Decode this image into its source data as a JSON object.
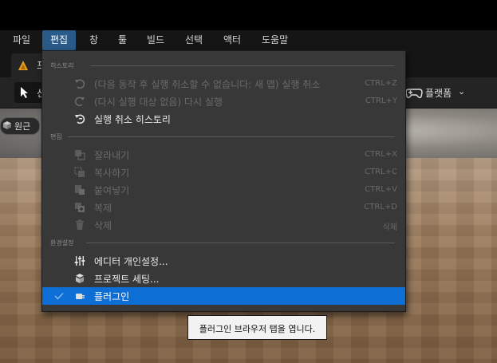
{
  "menubar": {
    "items": [
      "파일",
      "편집",
      "창",
      "툴",
      "빌드",
      "선택",
      "액터",
      "도움말"
    ],
    "active": "편집"
  },
  "doc_tab": {
    "label": "프"
  },
  "toolbar": {
    "select_label": "선",
    "platform_label": "플랫폼"
  },
  "viewport": {
    "perspective_label": "원근"
  },
  "dropdown": {
    "sections": [
      {
        "header": "히스토리",
        "items": [
          {
            "icon": "undo-icon",
            "label": "(다음 동작 후 실행 취소할 수 없습니다: 새 맵) 실행 취소",
            "shortcut": "CTRL+Z",
            "enabled": false
          },
          {
            "icon": "redo-icon",
            "label": "(다시 실행 대상 없음) 다시 실행",
            "shortcut": "CTRL+Y",
            "enabled": false
          },
          {
            "icon": "undo-history-icon",
            "label": "실행 취소 히스토리",
            "shortcut": "",
            "enabled": true
          }
        ]
      },
      {
        "header": "편집",
        "items": [
          {
            "icon": "cut-icon",
            "label": "잘라내기",
            "shortcut": "CTRL+X",
            "enabled": false
          },
          {
            "icon": "copy-icon",
            "label": "복사하기",
            "shortcut": "CTRL+C",
            "enabled": false
          },
          {
            "icon": "paste-icon",
            "label": "붙여넣기",
            "shortcut": "CTRL+V",
            "enabled": false
          },
          {
            "icon": "duplicate-icon",
            "label": "복제",
            "shortcut": "CTRL+D",
            "enabled": false
          },
          {
            "icon": "trash-icon",
            "label": "삭제",
            "shortcut": "삭제",
            "enabled": false
          }
        ]
      },
      {
        "header": "환경설정",
        "items": [
          {
            "icon": "sliders-icon",
            "label": "에디터 개인설정...",
            "shortcut": "",
            "enabled": true
          },
          {
            "icon": "project-settings-icon",
            "label": "프로젝트 세팅...",
            "shortcut": "",
            "enabled": true
          },
          {
            "icon": "plugin-icon",
            "label": "플러그인",
            "shortcut": "",
            "enabled": true,
            "highlighted": true
          }
        ]
      }
    ]
  },
  "tooltip": {
    "text": "플러그인 브라우저 탭을 엽니다."
  },
  "colors": {
    "highlight": "#0d6fd6",
    "menu_bg": "#383838",
    "active_menu": "#2a5a8a"
  }
}
